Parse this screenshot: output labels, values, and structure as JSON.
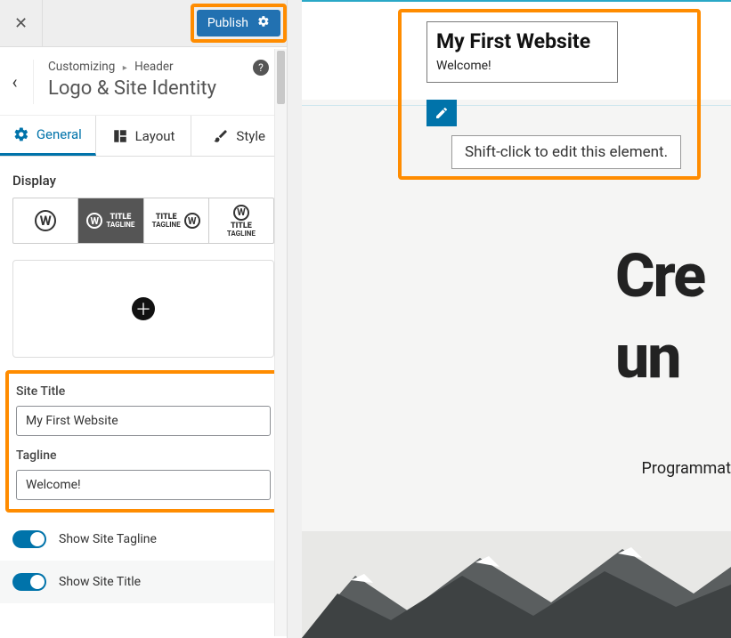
{
  "topbar": {
    "publish_label": "Publish"
  },
  "breadcrumb": {
    "root": "Customizing",
    "parent": "Header",
    "title": "Logo & Site Identity"
  },
  "tabs": {
    "general": "General",
    "layout": "Layout",
    "style": "Style"
  },
  "display": {
    "label": "Display",
    "options": [
      {
        "id": "logo-only",
        "selected": false
      },
      {
        "id": "logo-title-tagline-row",
        "selected": true,
        "text_top": "TITLE",
        "text_bottom": "TAGLINE"
      },
      {
        "id": "title-tagline-logo-row",
        "selected": false,
        "text_top": "TITLE",
        "text_bottom": "TAGLINE"
      },
      {
        "id": "logo-title-tagline-stack",
        "selected": false,
        "text_top": "TITLE",
        "text_bottom": "TAGLINE"
      }
    ]
  },
  "form": {
    "site_title_label": "Site Title",
    "site_title_value": "My First Website",
    "tagline_label": "Tagline",
    "tagline_value": "Welcome!"
  },
  "toggles": {
    "show_tagline": {
      "label": "Show Site Tagline",
      "on": true
    },
    "show_title": {
      "label": "Show Site Title",
      "on": true
    }
  },
  "preview": {
    "site_title": "My First Website",
    "tagline": "Welcome!",
    "tooltip": "Shift-click to edit this element.",
    "hero_line1": "Cre",
    "hero_line2": "un",
    "hero_sub": "Programmat"
  },
  "colors": {
    "accent": "#0073aa",
    "highlight": "#ff8c00"
  }
}
